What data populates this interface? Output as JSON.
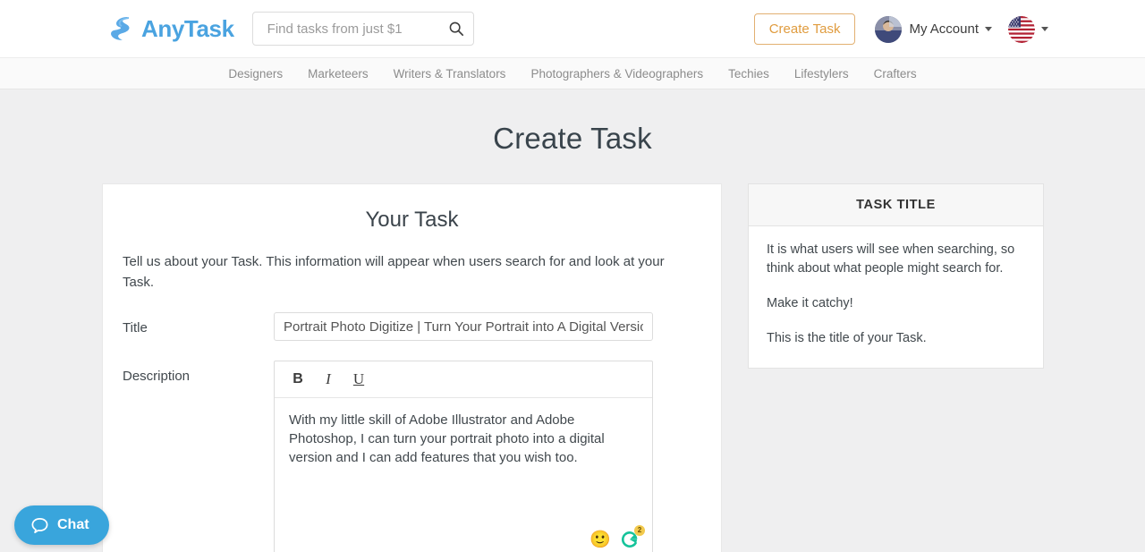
{
  "header": {
    "logo_text": "AnyTask",
    "logo_icon": "anytask-swirl-logo",
    "search_placeholder": "Find tasks from just $1",
    "search_value": "",
    "search_icon": "search-icon",
    "create_task_label": "Create Task",
    "account_label": "My Account",
    "account_avatar_icon": "user-avatar",
    "language_flag_icon": "us-flag-icon"
  },
  "nav": {
    "items": [
      {
        "label": "Designers"
      },
      {
        "label": "Marketeers"
      },
      {
        "label": "Writers & Translators"
      },
      {
        "label": "Photographers & Videographers"
      },
      {
        "label": "Techies"
      },
      {
        "label": "Lifestylers"
      },
      {
        "label": "Crafters"
      }
    ]
  },
  "page": {
    "title": "Create Task"
  },
  "form": {
    "heading": "Your Task",
    "description": "Tell us about your Task. This information will appear when users search for and look at your Task.",
    "title_field": {
      "label": "Title",
      "value": "Portrait Photo Digitize | Turn Your Portrait into A Digital Version",
      "placeholder": ""
    },
    "description_field": {
      "label": "Description",
      "value": "With my little skill of Adobe Illustrator and Adobe Photoshop, I can turn your portrait photo into a digital version and I can add features that you wish too.",
      "toolbar": {
        "bold": "B",
        "italic": "I",
        "underline": "U"
      },
      "emoji_icon": "smiley-emoji-icon",
      "grammarly_icon": "grammarly-icon",
      "grammarly_badge": "2"
    }
  },
  "side_panel": {
    "header": "TASK TITLE",
    "paragraphs": [
      "It is what users will see when searching, so think about what people might search for.",
      "Make it catchy!",
      "This is the title of your Task."
    ]
  },
  "chat": {
    "label": "Chat",
    "icon": "chat-bubble-icon"
  },
  "colors": {
    "brand_blue": "#4aa3e0",
    "accent_orange": "#e09c3f",
    "chat_blue": "#39a5dc",
    "page_bg": "#efeff0"
  }
}
